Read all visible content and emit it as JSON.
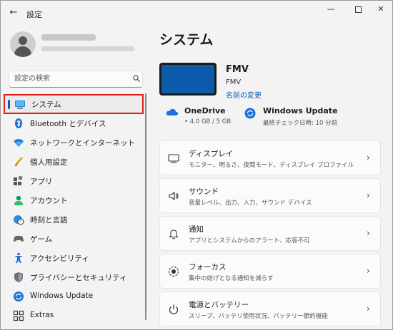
{
  "window": {
    "title": "設定"
  },
  "search": {
    "placeholder": "設定の検索"
  },
  "nav": [
    {
      "label": "システム",
      "icon": "display-icon",
      "active": true
    },
    {
      "label": "Bluetooth とデバイス",
      "icon": "bluetooth-icon"
    },
    {
      "label": "ネットワークとインターネット",
      "icon": "wifi-icon"
    },
    {
      "label": "個人用設定",
      "icon": "brush-icon"
    },
    {
      "label": "アプリ",
      "icon": "apps-icon"
    },
    {
      "label": "アカウント",
      "icon": "account-icon"
    },
    {
      "label": "時刻と言語",
      "icon": "globe-clock-icon"
    },
    {
      "label": "ゲーム",
      "icon": "gamepad-icon"
    },
    {
      "label": "アクセシビリティ",
      "icon": "accessibility-icon"
    },
    {
      "label": "プライバシーとセキュリティ",
      "icon": "shield-icon"
    },
    {
      "label": "Windows Update",
      "icon": "windows-update-icon"
    },
    {
      "label": "Extras",
      "icon": "extras-icon"
    }
  ],
  "main": {
    "title": "システム",
    "device": {
      "name": "FMV",
      "model": "FMV",
      "rename_link": "名前の変更"
    },
    "onedrive": {
      "title": "OneDrive",
      "storage": "4.0 GB / 5 GB"
    },
    "windows_update": {
      "title": "Windows Update",
      "last_checked": "最終チェック日時: 10 分前"
    },
    "cards": [
      {
        "title": "ディスプレイ",
        "subtitle": "モニター、明るさ、夜間モード、ディスプレイ プロファイル",
        "icon": "monitor-icon"
      },
      {
        "title": "サウンド",
        "subtitle": "音量レベル、出力、入力、サウンド デバイス",
        "icon": "speaker-icon"
      },
      {
        "title": "通知",
        "subtitle": "アプリとシステムからのアラート、応答不可",
        "icon": "bell-icon"
      },
      {
        "title": "フォーカス",
        "subtitle": "集中の妨げとなる通知を減らす",
        "icon": "focus-icon"
      },
      {
        "title": "電源とバッテリー",
        "subtitle": "スリープ、バッテリ使用状況、バッテリー節約機能",
        "icon": "power-icon"
      }
    ]
  },
  "colors": {
    "accent": "#005fb8",
    "highlight_border": "#e21b1b",
    "background": "#f3f3f3"
  }
}
